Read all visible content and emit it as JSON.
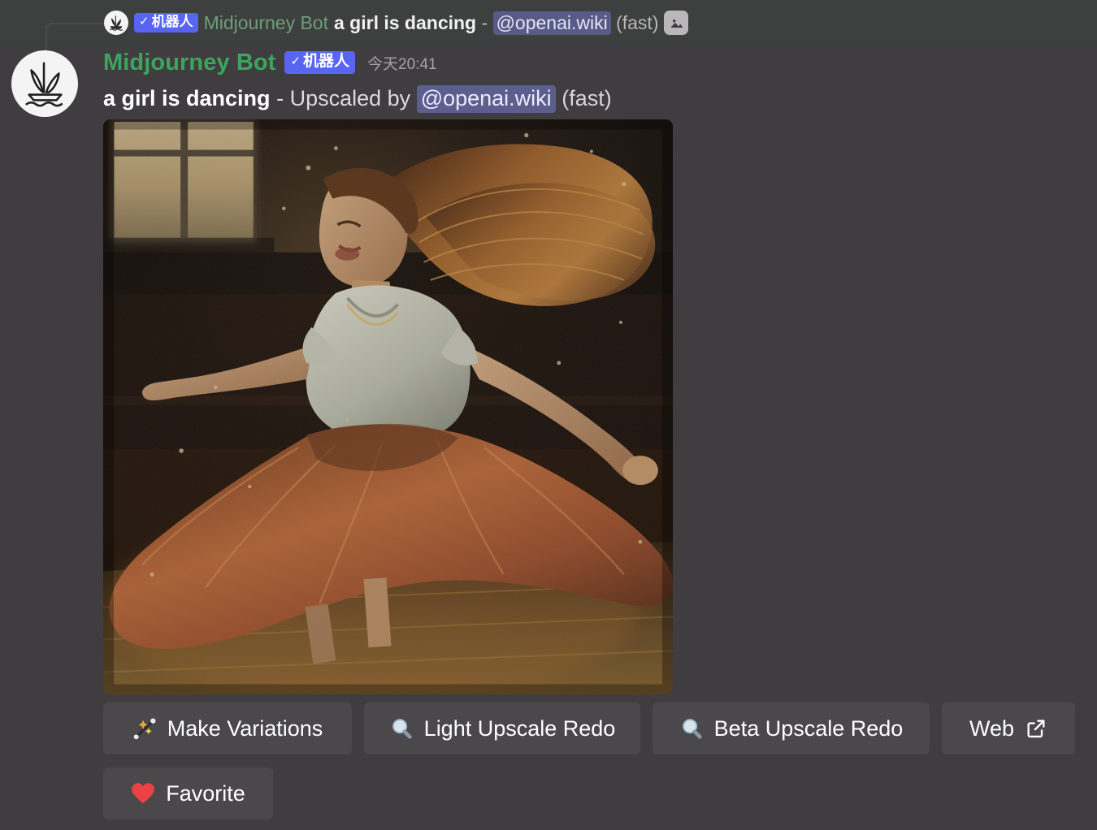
{
  "reply": {
    "avatar_icon": "midjourney-sailboat-icon",
    "bot_badge": "机器人",
    "bot_check": "✓",
    "author": "Midjourney Bot",
    "prompt": "a girl is dancing",
    "separator": "-",
    "mention": "@openai.wiki",
    "speed": "(fast)",
    "attachment_icon": "image-icon"
  },
  "message": {
    "avatar_icon": "midjourney-sailboat-icon",
    "author": "Midjourney Bot",
    "bot_badge": "机器人",
    "bot_check": "✓",
    "timestamp": "今天20:41",
    "prompt": "a girl is dancing",
    "separator": "-",
    "action": "Upscaled by",
    "mention": "@openai.wiki",
    "speed": "(fast)"
  },
  "artwork": {
    "alt": "Oil-painting style illustration of a girl with long flowing auburn hair dancing and spinning in a dark wooden room lit by a window, her amber skirt flaring outward",
    "palette": {
      "background": "#140f0d",
      "window_light": "#c3a97a",
      "skirt": "#c4663a",
      "hair": "#a85f2c",
      "blouse": "#cfd3c4",
      "floor": "#7a5a2e"
    }
  },
  "buttons": {
    "row1": [
      {
        "icon": "magic-wand-icon",
        "label": "Make Variations",
        "name": "make-variations-button"
      },
      {
        "icon": "magnifier-icon",
        "label": "Light Upscale Redo",
        "name": "light-upscale-redo-button"
      },
      {
        "icon": "magnifier-icon",
        "label": "Beta Upscale Redo",
        "name": "beta-upscale-redo-button"
      },
      {
        "icon": "external-link-icon",
        "label": "Web",
        "name": "web-button"
      }
    ],
    "row2": [
      {
        "icon": "heart-icon",
        "label": "Favorite",
        "name": "favorite-button"
      }
    ]
  },
  "colors": {
    "app_background": "#403d41",
    "reply_bar_background": "#3d403e",
    "bot_badge": "#5865f2",
    "author_name": "#3ba55d",
    "reply_author_name": "#6f9c78",
    "mention_background": "#5c5f8e",
    "button_background": "#4a484b",
    "heart": "#ed4245"
  }
}
